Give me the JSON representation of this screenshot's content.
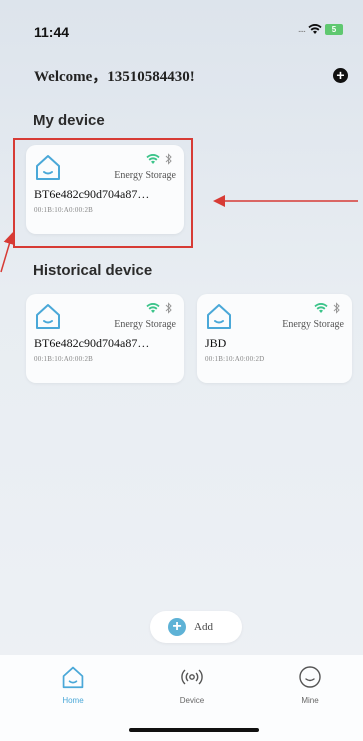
{
  "status_bar": {
    "time": "11:44",
    "signal": "....",
    "battery": "5"
  },
  "header": {
    "welcome": "Welcome，13510584430!"
  },
  "my_device": {
    "title": "My device",
    "cards": [
      {
        "type": "Energy Storage",
        "name": "BT6e482c90d704a87…",
        "mac": "00:1B:10:A0:00:2B"
      }
    ]
  },
  "historical_device": {
    "title": "Historical device",
    "cards": [
      {
        "type": "Energy Storage",
        "name": "BT6e482c90d704a87…",
        "mac": "00:1B:10:A0:00:2B"
      },
      {
        "type": "Energy Storage",
        "name": "JBD",
        "mac": "00:1B:10:A0:00:2D"
      }
    ]
  },
  "add_button": {
    "label": "Add"
  },
  "tabs": [
    {
      "label": "Home",
      "active": true
    },
    {
      "label": "Device",
      "active": false
    },
    {
      "label": "Mine",
      "active": false
    }
  ],
  "colors": {
    "accent": "#4aa8d8",
    "highlight": "#d73b35",
    "wifi": "#3cc48a"
  }
}
